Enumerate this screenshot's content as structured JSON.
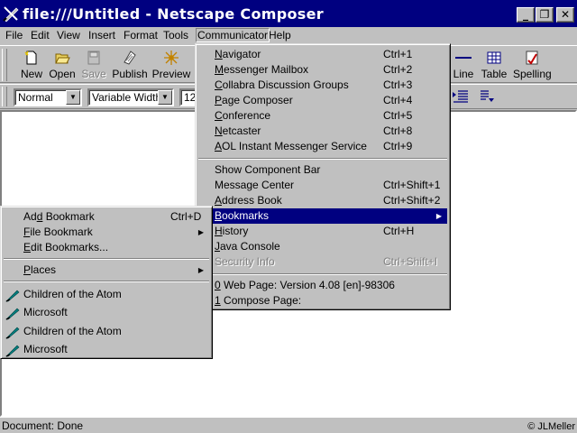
{
  "window": {
    "title": "file:///Untitled - Netscape Composer",
    "controls": {
      "minimize": "_",
      "maximize": "❐",
      "close": "✕"
    }
  },
  "menubar": {
    "items": [
      "File",
      "Edit",
      "View",
      "Insert",
      "Format",
      "Tools",
      "Communicator",
      "Help"
    ],
    "active": "Communicator"
  },
  "toolbar": {
    "buttons": [
      {
        "label": "New",
        "icon": "new-page-icon"
      },
      {
        "label": "Open",
        "icon": "open-folder-icon"
      },
      {
        "label": "Save",
        "icon": "save-disk-icon",
        "disabled": true
      },
      {
        "label": "Publish",
        "icon": "publish-icon"
      },
      {
        "label": "Preview",
        "icon": "preview-icon"
      },
      {
        "label": "Line",
        "icon": "horizontal-line-icon"
      },
      {
        "label": "Table",
        "icon": "table-icon"
      },
      {
        "label": "Spelling",
        "icon": "spelling-icon"
      }
    ]
  },
  "format_bar": {
    "paragraph_style": "Normal",
    "font": "Variable Width",
    "font_size": "12"
  },
  "communicator_menu": {
    "items": [
      {
        "label": "Navigator",
        "mnemonic": "N",
        "rest": "avigator",
        "shortcut": "Ctrl+1"
      },
      {
        "label": "Messenger Mailbox",
        "mnemonic": "M",
        "rest": "essenger Mailbox",
        "shortcut": "Ctrl+2"
      },
      {
        "label": "Collabra Discussion Groups",
        "mnemonic": "C",
        "rest": "ollabra Discussion Groups",
        "shortcut": "Ctrl+3"
      },
      {
        "label": "Page Composer",
        "mnemonic": "P",
        "rest": "age Composer",
        "shortcut": "Ctrl+4"
      },
      {
        "label": "Conference",
        "mnemonic": "C",
        "rest": "onference",
        "shortcut": "Ctrl+5"
      },
      {
        "label": "Netcaster",
        "mnemonic": "N",
        "rest": "etcaster",
        "shortcut": "Ctrl+8"
      },
      {
        "label": "AOL Instant Messenger Service",
        "mnemonic": "A",
        "rest": "OL Instant Messenger Service",
        "shortcut": "Ctrl+9"
      },
      {
        "label": "Show Component Bar",
        "shortcut": ""
      },
      {
        "label": "Message Center",
        "shortcut": "Ctrl+Shift+1"
      },
      {
        "label": "Address Book",
        "mnemonic": "A",
        "rest": "ddress Book",
        "shortcut": "Ctrl+Shift+2"
      },
      {
        "label": "Bookmarks",
        "mnemonic": "B",
        "rest": "ookmarks",
        "shortcut": "",
        "submenu": true,
        "highlighted": true
      },
      {
        "label": "History",
        "mnemonic": "H",
        "rest": "istory",
        "shortcut": "Ctrl+H"
      },
      {
        "label": "Java Console",
        "mnemonic": "J",
        "rest": "ava Console",
        "shortcut": ""
      },
      {
        "label": "Security Info",
        "shortcut": "Ctrl+Shift+I",
        "disabled": true
      },
      {
        "label": "0 Web Page: Version 4.08 [en]-98306",
        "mnemonic": "0",
        "rest": " Web Page: Version 4.08 [en]-98306",
        "shortcut": ""
      },
      {
        "label": "1 Compose Page:",
        "mnemonic": "1",
        "rest": " Compose Page:",
        "shortcut": ""
      }
    ]
  },
  "bookmarks_menu": {
    "items": [
      {
        "label": "Add Bookmark",
        "pre": "Ad",
        "mnemonic": "d",
        "rest": " Bookmark",
        "shortcut": "Ctrl+D"
      },
      {
        "label": "File Bookmark",
        "pre": "",
        "mnemonic": "F",
        "rest": "ile Bookmark",
        "submenu": true
      },
      {
        "label": "Edit Bookmarks...",
        "pre": "",
        "mnemonic": "E",
        "rest": "dit Bookmarks..."
      },
      {
        "label": "Places",
        "pre": "",
        "mnemonic": "P",
        "rest": "laces",
        "submenu": true
      },
      {
        "label": "Children of the Atom",
        "bookmark": true
      },
      {
        "label": "Microsoft",
        "bookmark": true
      },
      {
        "label": "Children of the Atom",
        "bookmark": true
      },
      {
        "label": "Microsoft",
        "bookmark": true
      }
    ]
  },
  "status": {
    "text": "Document: Done",
    "copyright": "© JLMeller"
  }
}
